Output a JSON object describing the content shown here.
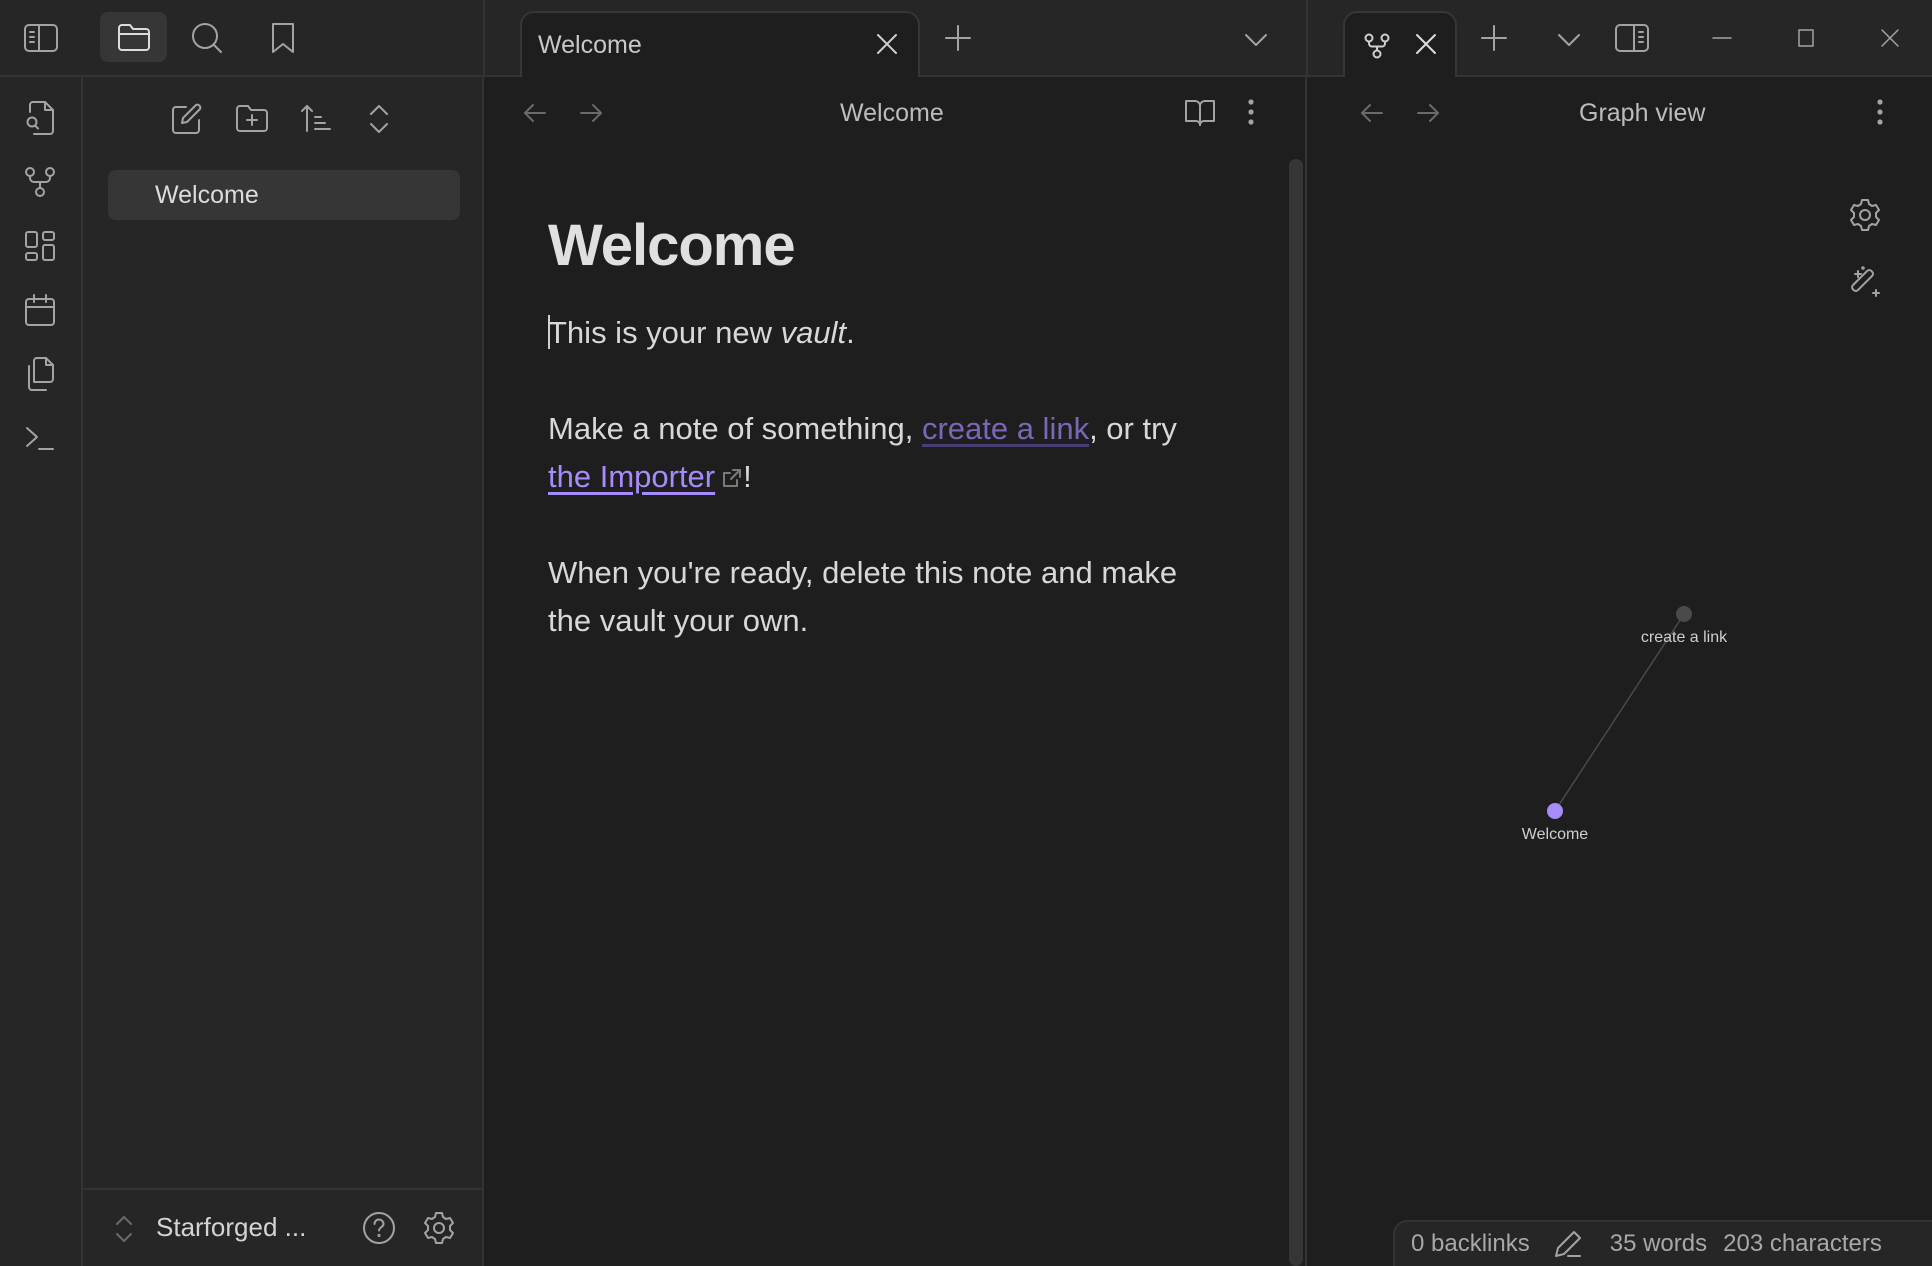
{
  "window": {
    "controls": {
      "minimize": "minimize",
      "maximize": "maximize",
      "close": "close"
    }
  },
  "left_topbar": {
    "buttons": [
      {
        "name": "toggle-sidebar",
        "icon": "sidebar-left-icon"
      },
      {
        "name": "files",
        "icon": "folder-icon",
        "active": true
      },
      {
        "name": "search",
        "icon": "search-icon"
      },
      {
        "name": "bookmarks",
        "icon": "bookmark-icon"
      }
    ]
  },
  "ribbon": {
    "items": [
      {
        "name": "quick-switcher",
        "icon": "file-search-icon"
      },
      {
        "name": "graph-view",
        "icon": "graph-icon"
      },
      {
        "name": "canvas",
        "icon": "layout-dashboard-icon"
      },
      {
        "name": "daily-note",
        "icon": "calendar-icon"
      },
      {
        "name": "templates",
        "icon": "copy-icon"
      },
      {
        "name": "command-palette",
        "icon": "terminal-icon"
      }
    ]
  },
  "sidebar": {
    "actions": [
      {
        "name": "new-note",
        "icon": "edit-icon"
      },
      {
        "name": "new-folder",
        "icon": "folder-plus-icon"
      },
      {
        "name": "sort",
        "icon": "sort-ascending-icon"
      },
      {
        "name": "expand-collapse",
        "icon": "chevrons-up-down-icon"
      }
    ],
    "files": [
      {
        "label": "Welcome",
        "active": true
      }
    ],
    "footer": {
      "vault_name": "Starforged ...",
      "help_icon": "help-circle-icon",
      "settings_icon": "gear-icon"
    }
  },
  "editor": {
    "tab": {
      "title": "Welcome"
    },
    "header": {
      "title": "Welcome"
    },
    "note": {
      "title": "Welcome",
      "p1_text": "This is your new ",
      "p1_italic": "vault",
      "p1_end": ".",
      "p2_text": "Make a note of something, ",
      "p2_link_internal": "create a link",
      "p2_mid": ", or try ",
      "p2_link_external": "the Importer",
      "p2_end": "!",
      "p3_text": "When you're ready, delete this note and make the vault your own."
    }
  },
  "graph": {
    "header": {
      "title": "Graph view"
    },
    "nodes": [
      {
        "id": "welcome",
        "label": "Welcome",
        "color": "#a88bfa",
        "active": true
      },
      {
        "id": "create-a-link",
        "label": "create a link",
        "color": "#4a4a4a",
        "active": false
      }
    ],
    "edges": [
      {
        "from": "welcome",
        "to": "create-a-link"
      }
    ]
  },
  "statusbar": {
    "backlinks": "0 backlinks",
    "words": "35 words",
    "characters": "203 characters"
  },
  "colors": {
    "accent": "#a88bfa",
    "internal_link": "#7c66b8"
  }
}
